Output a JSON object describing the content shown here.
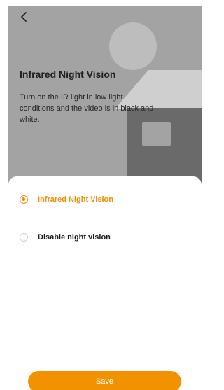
{
  "header": {
    "back_icon": "chevron-left-icon"
  },
  "hero": {
    "title": "Infrared Night Vision",
    "description": "Turn on the IR light in low light conditions and the video is in black and white.",
    "illustration": "moon-and-house-illustration"
  },
  "options": [
    {
      "label": "Infrared Night Vision",
      "selected": true
    },
    {
      "label": "Disable night vision",
      "selected": false
    }
  ],
  "footer": {
    "save_label": "Save"
  },
  "colors": {
    "accent": "#f39200",
    "hero_background": "#a3a3a3",
    "text_dark": "#1a1a1a"
  }
}
